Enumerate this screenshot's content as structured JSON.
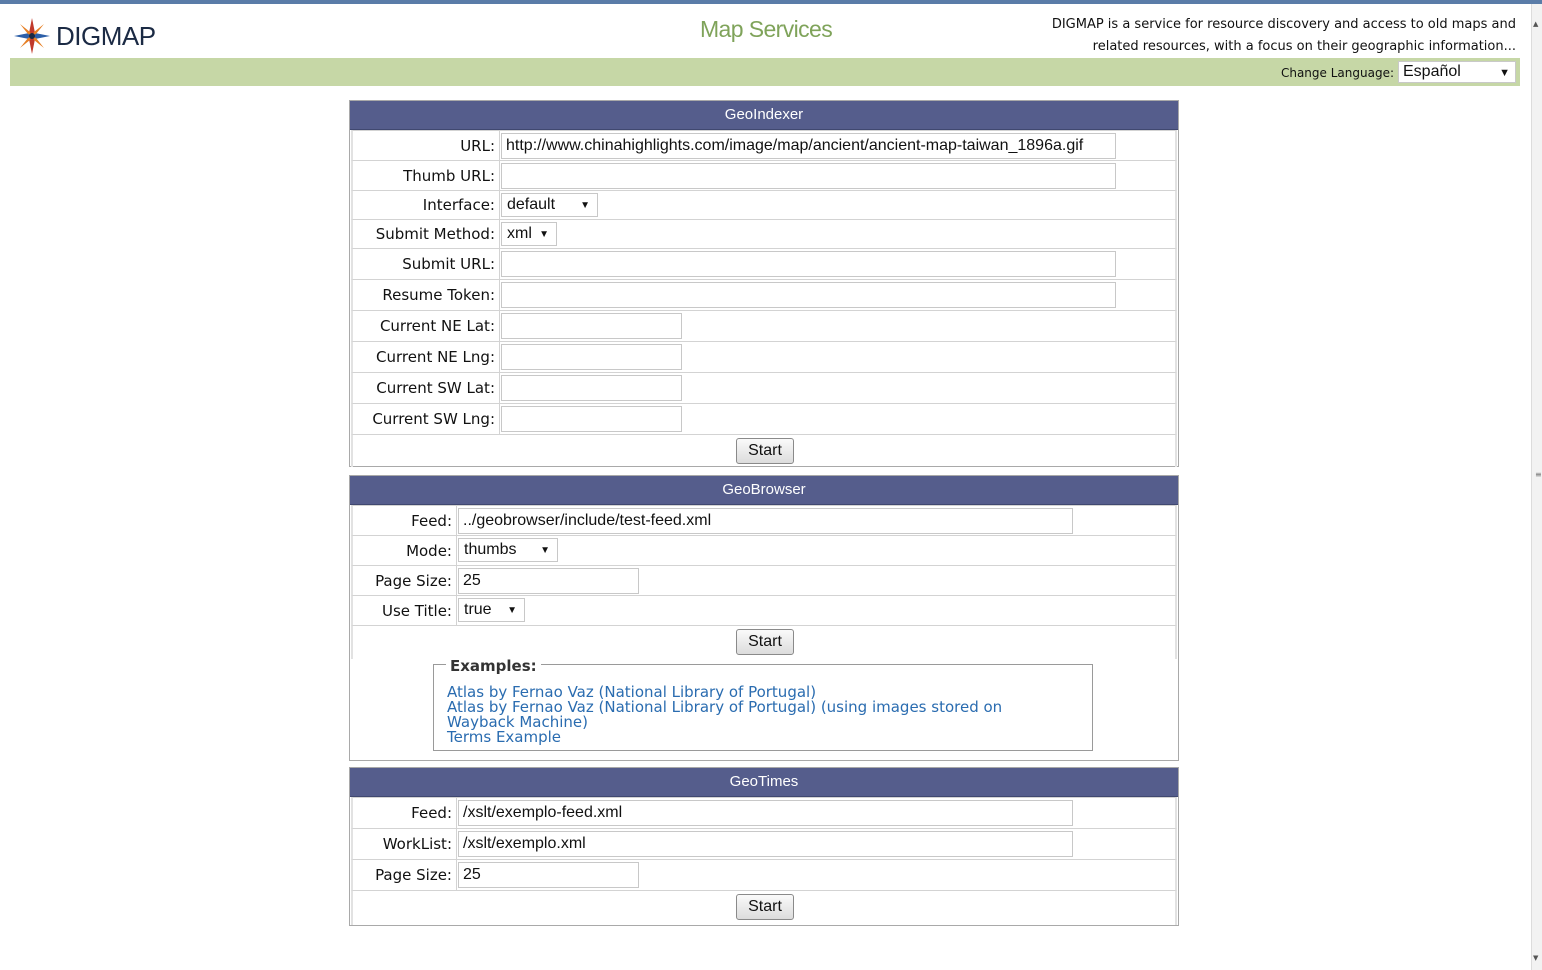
{
  "header": {
    "logo_text": "DIGMAP",
    "page_title": "Map Services",
    "description_line1": "DIGMAP is a service for resource discovery and access to old maps and",
    "description_line2": "related resources, with a focus on their geographic information...",
    "change_language_label": "Change Language:",
    "language_value": "Español"
  },
  "geoindexer": {
    "title": "GeoIndexer",
    "fields": [
      {
        "label": "URL:",
        "value": "http://www.chinahighlights.com/image/map/ancient/ancient-map-taiwan_1896a.gif"
      },
      {
        "label": "Thumb URL:",
        "value": ""
      },
      {
        "label": "Interface:",
        "value": "default"
      },
      {
        "label": "Submit Method:",
        "value": "xml"
      },
      {
        "label": "Submit URL:",
        "value": ""
      },
      {
        "label": "Resume Token:",
        "value": ""
      },
      {
        "label": "Current NE Lat:",
        "value": ""
      },
      {
        "label": "Current NE Lng:",
        "value": ""
      },
      {
        "label": "Current SW Lat:",
        "value": ""
      },
      {
        "label": "Current SW Lng:",
        "value": ""
      }
    ],
    "start_label": "Start"
  },
  "geobrowser": {
    "title": "GeoBrowser",
    "fields": [
      {
        "label": "Feed:",
        "value": "../geobrowser/include/test-feed.xml"
      },
      {
        "label": "Mode:",
        "value": "thumbs"
      },
      {
        "label": "Page Size:",
        "value": "25"
      },
      {
        "label": "Use Title:",
        "value": "true"
      }
    ],
    "start_label": "Start",
    "examples_legend": "Examples:",
    "examples": [
      "Atlas by Fernao Vaz (National Library of Portugal)",
      "Atlas by Fernao Vaz (National Library of Portugal) (using images stored on",
      "Wayback Machine)",
      "Terms Example"
    ]
  },
  "geotimes": {
    "title": "GeoTimes",
    "fields": [
      {
        "label": "Feed:",
        "value": "/xslt/exemplo-feed.xml"
      },
      {
        "label": "WorkList:",
        "value": "/xslt/exemplo.xml"
      },
      {
        "label": "Page Size:",
        "value": "25"
      }
    ],
    "start_label": "Start"
  },
  "colors": {
    "panel_header": "#555d8c",
    "green_bar": "#c6d7a6",
    "title_green": "#7fa35a",
    "link": "#2a6cb0"
  }
}
